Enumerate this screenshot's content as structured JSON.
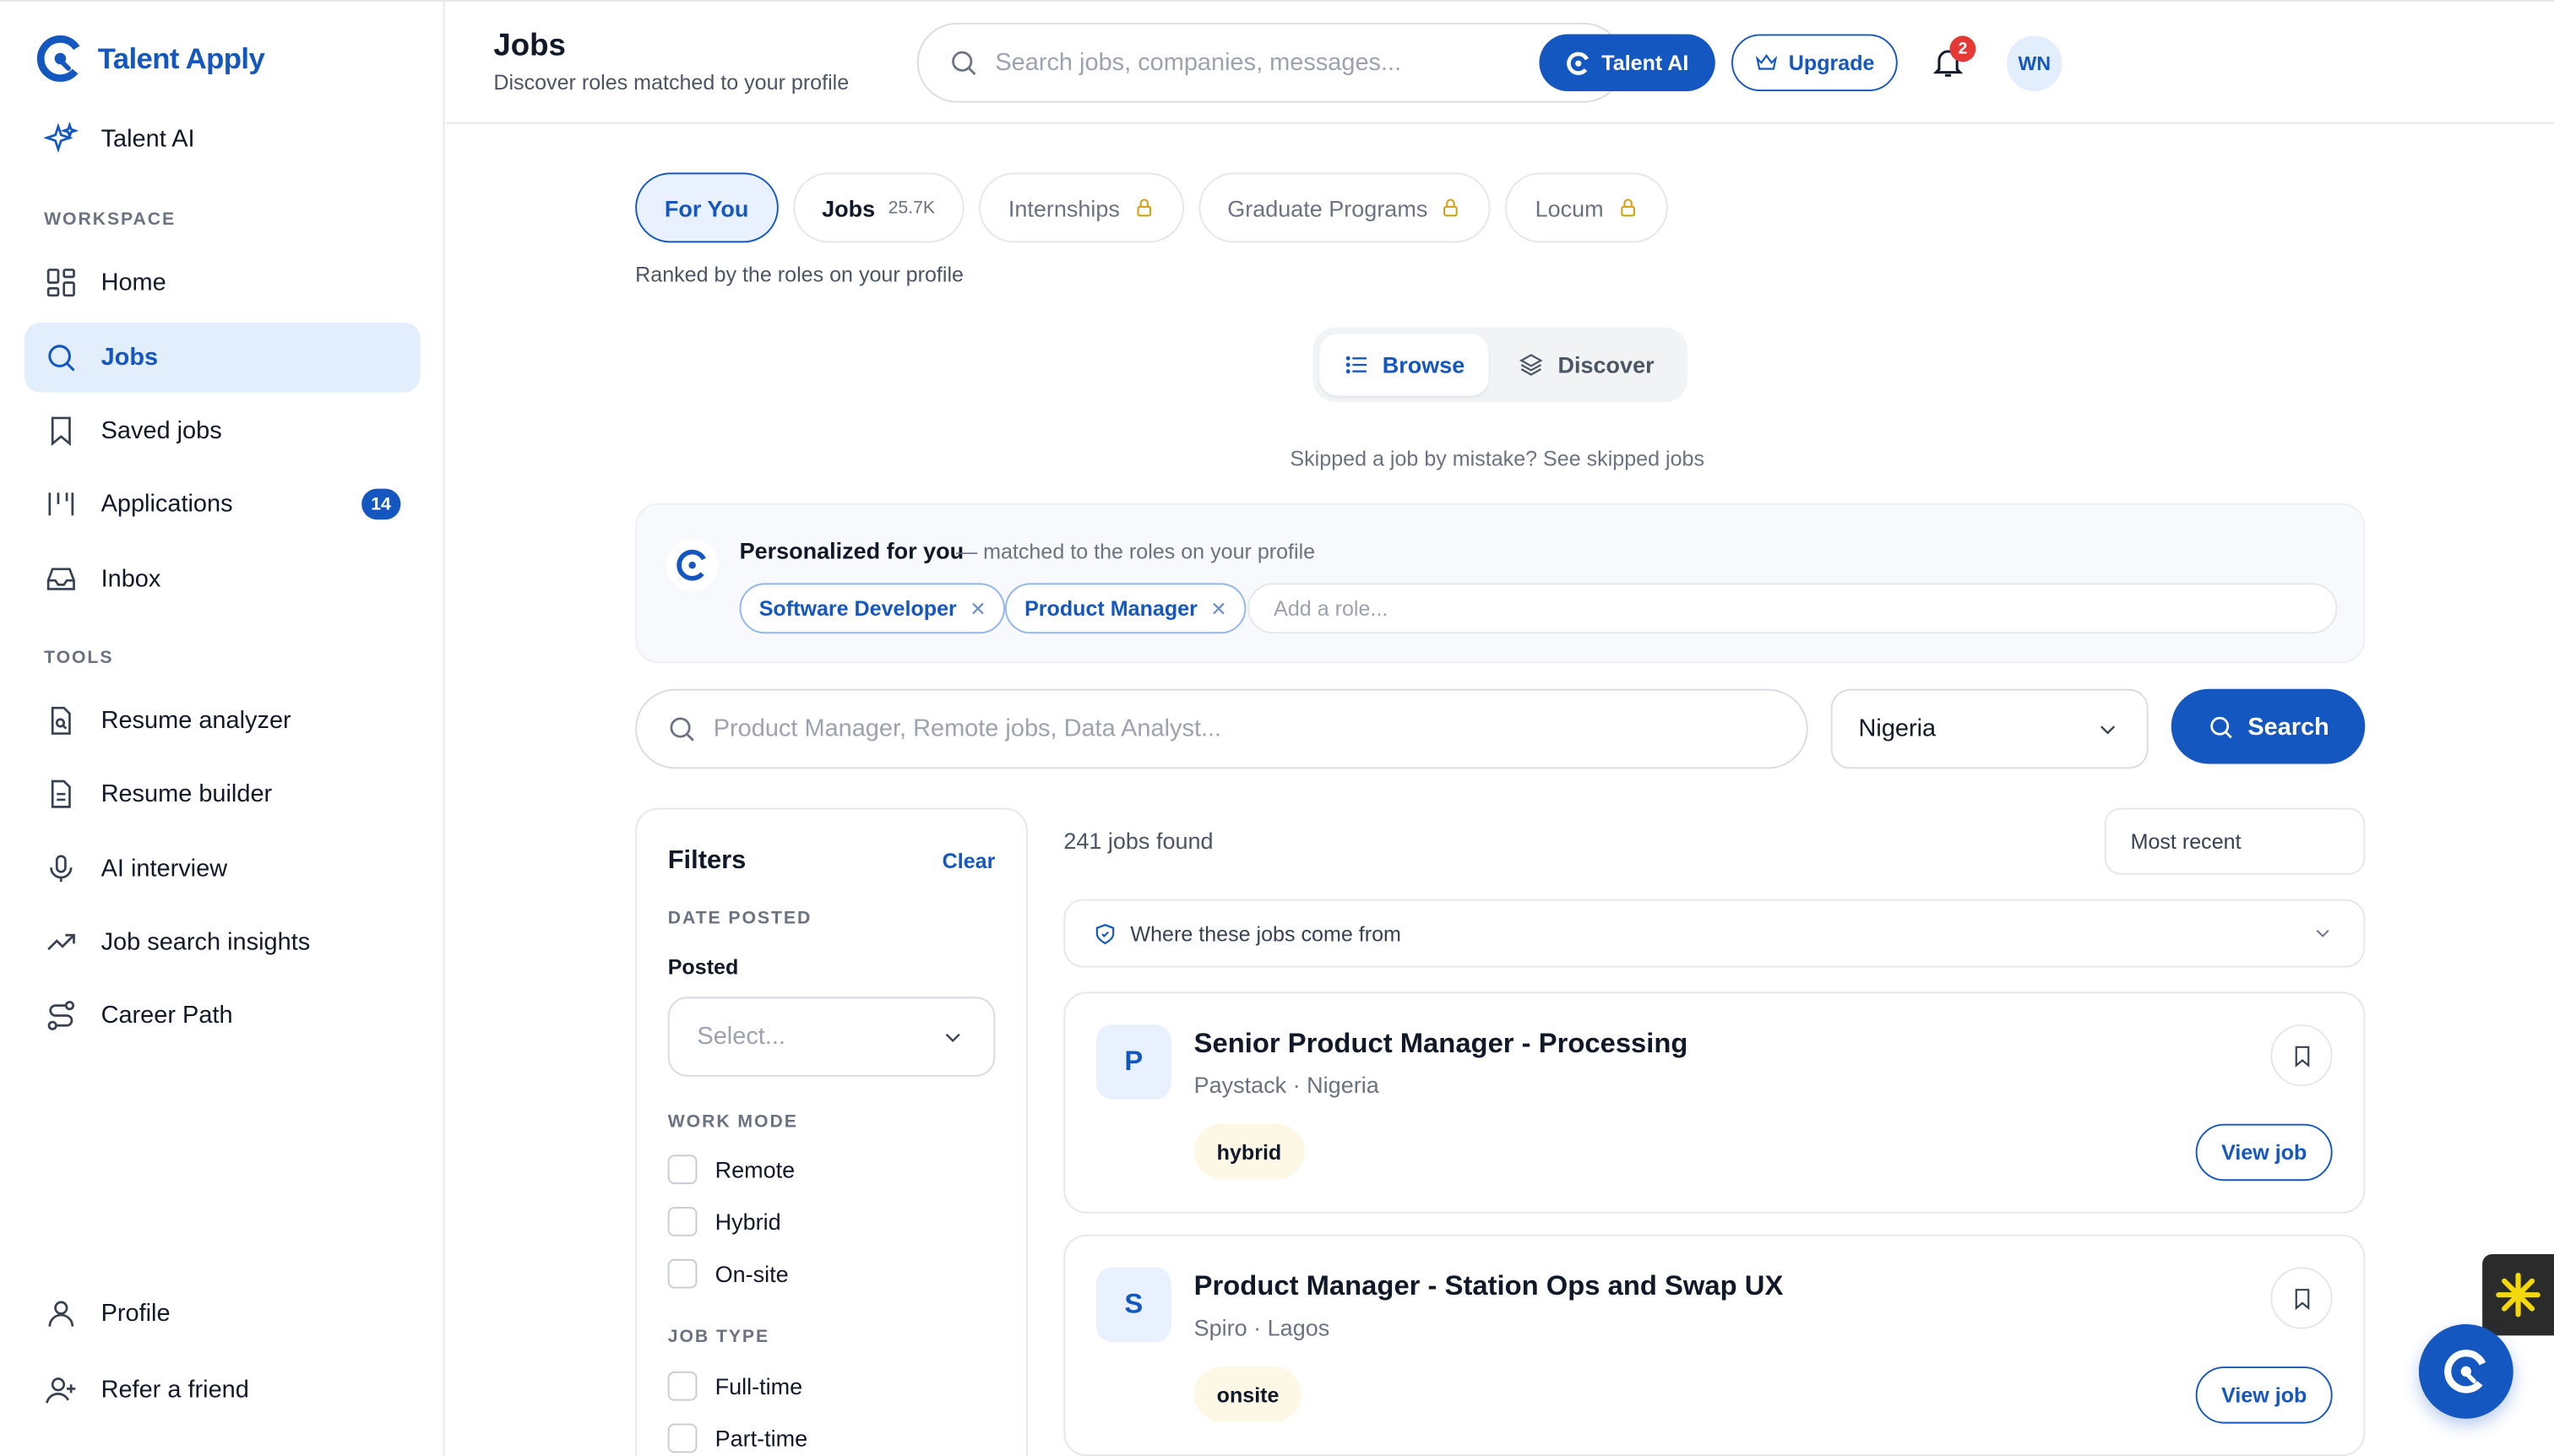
{
  "app": {
    "name": "Talent Apply"
  },
  "sidebar": {
    "talent_ai": "Talent AI",
    "workspace_label": "WORKSPACE",
    "tools_label": "TOOLS",
    "items": [
      {
        "label": "Home",
        "icon": "grid-icon"
      },
      {
        "label": "Jobs",
        "icon": "search-icon",
        "active": true
      },
      {
        "label": "Saved jobs",
        "icon": "bookmark-icon"
      },
      {
        "label": "Applications",
        "icon": "columns-icon",
        "badge": "14"
      },
      {
        "label": "Inbox",
        "icon": "inbox-icon"
      }
    ],
    "tools": [
      {
        "label": "Resume analyzer",
        "icon": "file-search-icon"
      },
      {
        "label": "Resume builder",
        "icon": "file-text-icon"
      },
      {
        "label": "AI interview",
        "icon": "microphone-icon"
      },
      {
        "label": "Job search insights",
        "icon": "trending-up-icon"
      },
      {
        "label": "Career Path",
        "icon": "route-icon"
      }
    ],
    "bottom": [
      {
        "label": "Profile",
        "icon": "user-icon"
      },
      {
        "label": "Refer a friend",
        "icon": "user-plus-icon"
      }
    ]
  },
  "header": {
    "title": "Jobs",
    "subtitle": "Discover roles matched to your profile",
    "search_placeholder": "Search jobs, companies, messages...",
    "talent_ai_label": "Talent AI",
    "upgrade_label": "Upgrade",
    "notification_count": "2",
    "avatar_initials": "WN"
  },
  "tabs": [
    {
      "label": "For You",
      "active": true
    },
    {
      "label": "Jobs",
      "count": "25.7K"
    },
    {
      "label": "Internships",
      "locked": true
    },
    {
      "label": "Graduate Programs",
      "locked": true
    },
    {
      "label": "Locum",
      "locked": true
    }
  ],
  "ranked_text": "Ranked by the roles on your profile",
  "view_toggle": {
    "browse": "Browse",
    "discover": "Discover"
  },
  "skipped_text": "Skipped a job by mistake? See skipped jobs",
  "personalized": {
    "title": "Personalized for you",
    "subtitle": "— matched to the roles on your profile",
    "chips": [
      "Software Developer",
      "Product Manager"
    ],
    "add_placeholder": "Add a role..."
  },
  "search": {
    "placeholder": "Product Manager, Remote jobs, Data Analyst...",
    "country": "Nigeria",
    "button": "Search"
  },
  "filters": {
    "title": "Filters",
    "clear": "Clear",
    "date_posted_label": "DATE POSTED",
    "posted_label": "Posted",
    "posted_placeholder": "Select...",
    "work_mode_label": "WORK MODE",
    "work_modes": [
      "Remote",
      "Hybrid",
      "On-site"
    ],
    "job_type_label": "JOB TYPE",
    "job_types": [
      "Full-time",
      "Part-time"
    ]
  },
  "results": {
    "count_text": "241 jobs found",
    "sort": "Most recent",
    "source_text": "Where these jobs come from",
    "jobs": [
      {
        "logo": "P",
        "title": "Senior Product Manager - Processing",
        "meta": "Paystack · Nigeria",
        "tag": "hybrid",
        "cta": "View job"
      },
      {
        "logo": "S",
        "title": "Product Manager - Station Ops and Swap UX",
        "meta": "Spiro · Lagos",
        "tag": "onsite",
        "cta": "View job"
      }
    ]
  },
  "colors": {
    "brand": "#1557c0",
    "active_bg": "#e3eefc",
    "tag_bg": "#fdf8e6"
  }
}
